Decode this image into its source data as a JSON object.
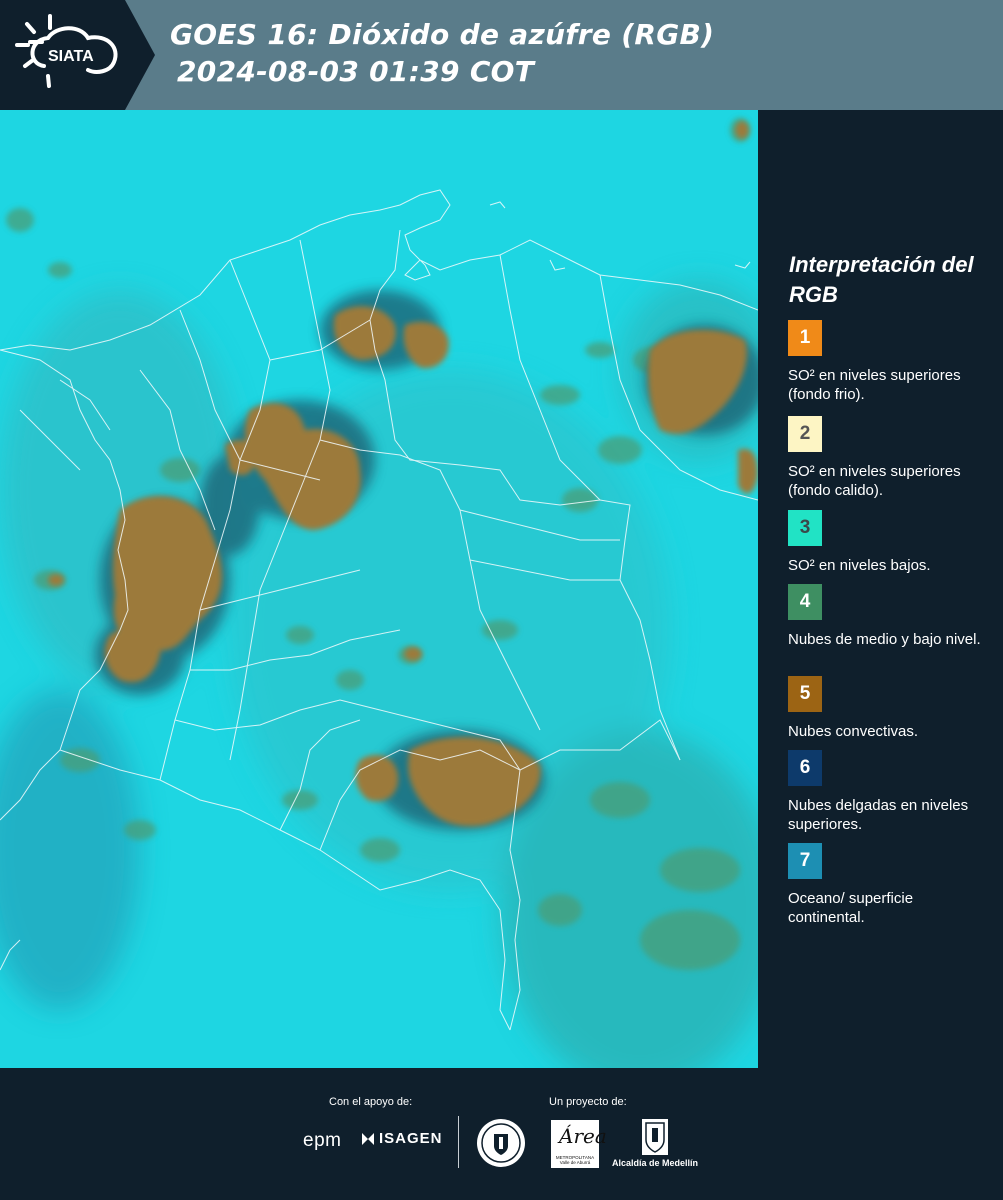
{
  "header": {
    "logo_text": "SIATA",
    "title_line1": "GOES 16: Dióxido de azúfre (RGB)",
    "title_line2": "2024-08-03 01:39 COT",
    "background_color": "#5a7c8a"
  },
  "map": {
    "description_icon": "satellite-map",
    "background_color": "#1ed6e2",
    "cloud_color": "#9c7a3a",
    "border_color": "#ffffff"
  },
  "legend": {
    "title": "Interpretación del RGB",
    "items": [
      {
        "number": "1",
        "color": "#f08a18",
        "text": "SO² en niveles superiores (fondo frio)."
      },
      {
        "number": "2",
        "color": "#fdf5c4",
        "text": "SO² en niveles superiores (fondo calido)."
      },
      {
        "number": "3",
        "color": "#21e3c5",
        "text": "SO² en niveles bajos."
      },
      {
        "number": "4",
        "color": "#3e8f62",
        "text": "Nubes de medio y bajo nivel."
      },
      {
        "number": "5",
        "color": "#9c6414",
        "text": "Nubes convectivas."
      },
      {
        "number": "6",
        "color": "#0d3a6b",
        "text": "Nubes delgadas en niveles superiores."
      },
      {
        "number": "7",
        "color": "#1d8fb3",
        "text": "Oceano/ superficie continental."
      }
    ]
  },
  "footer": {
    "support_label": "Con el apoyo de:",
    "project_label": "Un proyecto de:",
    "sponsors": [
      "epm",
      "ISAGEN"
    ],
    "partners": [
      "Área Metropolitana Valle de Aburrá",
      "Alcaldía de Medellín"
    ],
    "epm_text": "epm",
    "isagen_text": "ISAGEN",
    "area_mark": "Área",
    "area_sub": "METROPOLITANA Valle de Aburrá",
    "alcaldia_text": "Alcaldía de Medellín"
  }
}
